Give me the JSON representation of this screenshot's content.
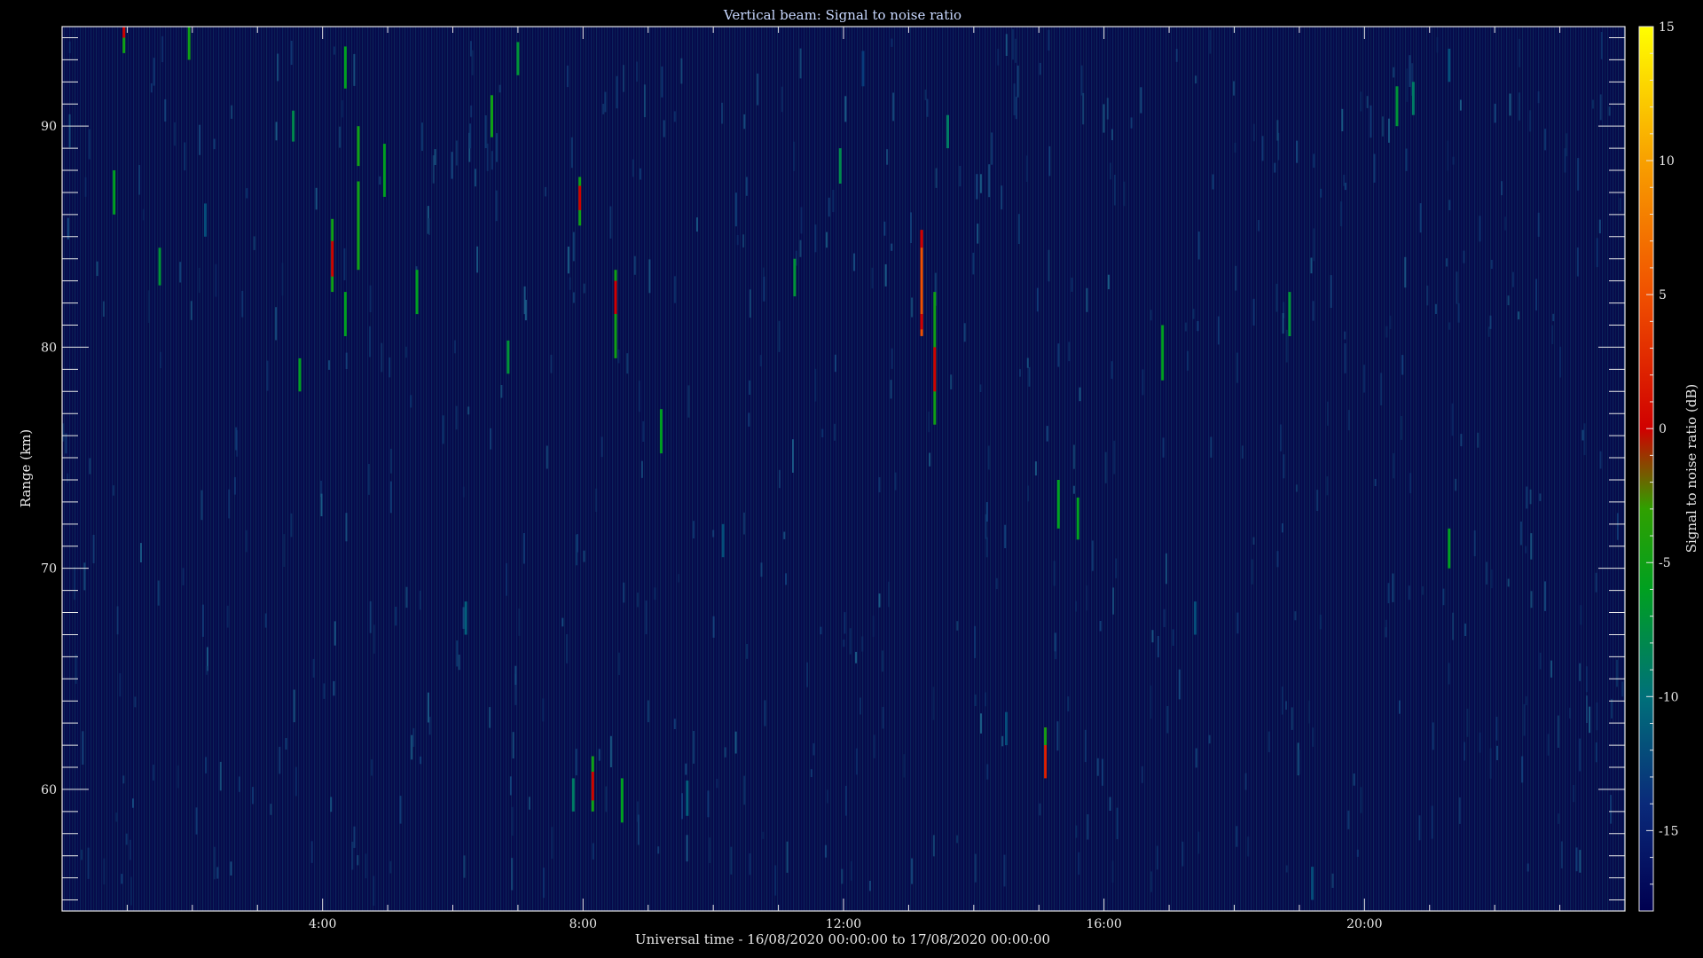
{
  "chart_data": {
    "type": "heatmap",
    "title": "Vertical beam: Signal to noise ratio",
    "xlabel": "Universal time - 16/08/2020 00:00:00 to 17/08/2020 00:00:00",
    "ylabel": "Range (km)",
    "colorbar_label": "Signal to noise ratio (dB)",
    "x_unit": "hours UT",
    "xlim": [
      0,
      24
    ],
    "ylim": [
      54.5,
      94.5
    ],
    "clim": [
      -18,
      15
    ],
    "x_ticks": [
      {
        "value": 4,
        "label": "4:00"
      },
      {
        "value": 8,
        "label": "8:00"
      },
      {
        "value": 12,
        "label": "12:00"
      },
      {
        "value": 16,
        "label": "16:00"
      },
      {
        "value": 20,
        "label": "20:00"
      }
    ],
    "y_ticks": [
      {
        "value": 60,
        "label": "60"
      },
      {
        "value": 70,
        "label": "70"
      },
      {
        "value": 80,
        "label": "80"
      },
      {
        "value": 90,
        "label": "90"
      }
    ],
    "colorbar_ticks": [
      {
        "value": 15,
        "label": "15"
      },
      {
        "value": 10,
        "label": "10"
      },
      {
        "value": 5,
        "label": "5"
      },
      {
        "value": 0,
        "label": "0"
      },
      {
        "value": -5,
        "label": "-5"
      },
      {
        "value": -10,
        "label": "-10"
      },
      {
        "value": -15,
        "label": "-15"
      }
    ],
    "background_snr_db": -16,
    "colormap": [
      {
        "value": -18,
        "color": "#000050"
      },
      {
        "value": -14,
        "color": "#0a2a7a"
      },
      {
        "value": -10,
        "color": "#00707a"
      },
      {
        "value": -6,
        "color": "#00a020"
      },
      {
        "value": -3,
        "color": "#30a000"
      },
      {
        "value": 0,
        "color": "#d00000"
      },
      {
        "value": 5,
        "color": "#f05000"
      },
      {
        "value": 10,
        "color": "#f8a000"
      },
      {
        "value": 15,
        "color": "#ffff00"
      }
    ],
    "echoes": [
      {
        "t": 0.95,
        "r0": 94.0,
        "r1": 94.5,
        "snr": 0
      },
      {
        "t": 0.95,
        "r0": 93.3,
        "r1": 94.0,
        "snr": -5
      },
      {
        "t": 1.95,
        "r0": 93.0,
        "r1": 94.5,
        "snr": -5
      },
      {
        "t": 0.8,
        "r0": 86.0,
        "r1": 88.0,
        "snr": -6
      },
      {
        "t": 1.5,
        "r0": 82.8,
        "r1": 84.5,
        "snr": -7
      },
      {
        "t": 3.55,
        "r0": 89.3,
        "r1": 90.7,
        "snr": -8
      },
      {
        "t": 3.65,
        "r0": 78.0,
        "r1": 79.5,
        "snr": -6
      },
      {
        "t": 4.15,
        "r0": 82.5,
        "r1": 85.8,
        "snr": -5
      },
      {
        "t": 4.15,
        "r0": 83.2,
        "r1": 84.8,
        "snr": 0
      },
      {
        "t": 4.35,
        "r0": 91.7,
        "r1": 93.6,
        "snr": -6
      },
      {
        "t": 4.35,
        "r0": 80.5,
        "r1": 82.5,
        "snr": -6
      },
      {
        "t": 4.55,
        "r0": 88.2,
        "r1": 90.0,
        "snr": -5
      },
      {
        "t": 4.55,
        "r0": 83.5,
        "r1": 87.5,
        "snr": -5
      },
      {
        "t": 4.95,
        "r0": 86.8,
        "r1": 89.2,
        "snr": -6
      },
      {
        "t": 5.45,
        "r0": 81.5,
        "r1": 83.5,
        "snr": -6
      },
      {
        "t": 6.6,
        "r0": 89.5,
        "r1": 91.4,
        "snr": -5
      },
      {
        "t": 6.85,
        "r0": 78.8,
        "r1": 80.3,
        "snr": -7
      },
      {
        "t": 7.0,
        "r0": 92.3,
        "r1": 93.8,
        "snr": -7
      },
      {
        "t": 7.95,
        "r0": 85.5,
        "r1": 87.7,
        "snr": -5
      },
      {
        "t": 7.95,
        "r0": 86.2,
        "r1": 87.3,
        "snr": 0
      },
      {
        "t": 8.5,
        "r0": 79.5,
        "r1": 83.5,
        "snr": -5
      },
      {
        "t": 8.5,
        "r0": 81.5,
        "r1": 83.0,
        "snr": 0
      },
      {
        "t": 8.15,
        "r0": 59.0,
        "r1": 61.5,
        "snr": -5
      },
      {
        "t": 8.15,
        "r0": 59.5,
        "r1": 60.8,
        "snr": 0
      },
      {
        "t": 8.6,
        "r0": 58.5,
        "r1": 60.5,
        "snr": -6
      },
      {
        "t": 7.85,
        "r0": 59.0,
        "r1": 60.5,
        "snr": -9
      },
      {
        "t": 9.2,
        "r0": 75.2,
        "r1": 77.2,
        "snr": -6
      },
      {
        "t": 11.25,
        "r0": 82.3,
        "r1": 84.0,
        "snr": -7
      },
      {
        "t": 11.95,
        "r0": 87.4,
        "r1": 89.0,
        "snr": -8
      },
      {
        "t": 13.2,
        "r0": 80.5,
        "r1": 85.3,
        "snr": 5
      },
      {
        "t": 13.2,
        "r0": 84.5,
        "r1": 85.3,
        "snr": 0
      },
      {
        "t": 13.2,
        "r0": 80.8,
        "r1": 81.5,
        "snr": 0
      },
      {
        "t": 13.4,
        "r0": 76.5,
        "r1": 82.5,
        "snr": -5
      },
      {
        "t": 13.4,
        "r0": 78.0,
        "r1": 80.0,
        "snr": 0
      },
      {
        "t": 13.6,
        "r0": 89.0,
        "r1": 90.5,
        "snr": -9
      },
      {
        "t": 15.1,
        "r0": 60.5,
        "r1": 62.8,
        "snr": 2
      },
      {
        "t": 15.1,
        "r0": 62.0,
        "r1": 62.8,
        "snr": -5
      },
      {
        "t": 15.3,
        "r0": 71.8,
        "r1": 74.0,
        "snr": -6
      },
      {
        "t": 15.6,
        "r0": 71.3,
        "r1": 73.2,
        "snr": -6
      },
      {
        "t": 16.9,
        "r0": 78.5,
        "r1": 81.0,
        "snr": -6
      },
      {
        "t": 18.85,
        "r0": 80.5,
        "r1": 82.5,
        "snr": -7
      },
      {
        "t": 20.5,
        "r0": 90.0,
        "r1": 91.8,
        "snr": -7
      },
      {
        "t": 20.75,
        "r0": 90.5,
        "r1": 92.0,
        "snr": -9
      },
      {
        "t": 21.3,
        "r0": 70.0,
        "r1": 71.8,
        "snr": -6
      },
      {
        "t": 21.3,
        "r0": 92.0,
        "r1": 93.5,
        "snr": -12
      },
      {
        "t": 12.3,
        "r0": 91.8,
        "r1": 93.4,
        "snr": -13
      },
      {
        "t": 2.2,
        "r0": 85.0,
        "r1": 86.5,
        "snr": -12
      },
      {
        "t": 6.2,
        "r0": 67.0,
        "r1": 68.5,
        "snr": -11
      },
      {
        "t": 10.15,
        "r0": 70.5,
        "r1": 72.0,
        "snr": -12
      },
      {
        "t": 9.6,
        "r0": 58.8,
        "r1": 60.4,
        "snr": -11
      },
      {
        "t": 14.5,
        "r0": 62.0,
        "r1": 63.5,
        "snr": -12
      },
      {
        "t": 17.4,
        "r0": 67.0,
        "r1": 68.5,
        "snr": -12
      },
      {
        "t": 19.2,
        "r0": 55.0,
        "r1": 56.5,
        "snr": -12
      }
    ]
  }
}
